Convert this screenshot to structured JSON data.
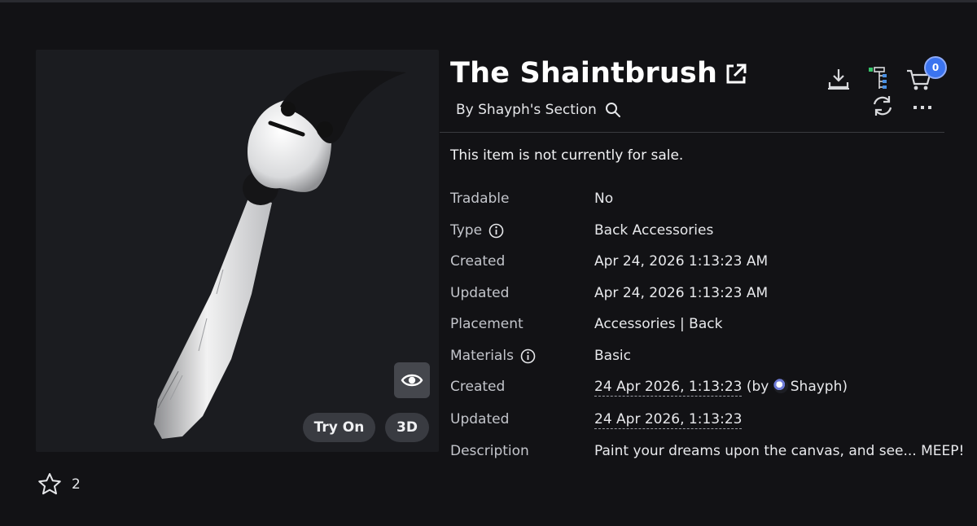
{
  "item": {
    "title": "The Shaintbrush",
    "byline": "By Shayph's Section",
    "sale_note": "This item is not currently for sale.",
    "favorite_count": "2"
  },
  "preview": {
    "try_on_label": "Try On",
    "three_d_label": "3D"
  },
  "toolbar": {
    "cart_count": "0"
  },
  "details": [
    {
      "label": "Tradable",
      "value": "No"
    },
    {
      "label": "Type",
      "value": "Back Accessories"
    },
    {
      "label": "Created",
      "value": "Apr 24, 2026 1:13:23 AM"
    },
    {
      "label": "Updated",
      "value": "Apr 24, 2026 1:13:23 AM"
    },
    {
      "label": "Placement",
      "value": "Accessories | Back"
    },
    {
      "label": "Materials",
      "value": "Basic"
    },
    {
      "label": "Created",
      "value": "24 Apr 2026, 1:13:23",
      "prefix": "(by ",
      "creator": "Shayph",
      "suffix": ")"
    },
    {
      "label": "Updated",
      "value": "24 Apr 2026, 1:13:23"
    },
    {
      "label": "Description",
      "value": "Paint your dreams upon the canvas, and see... MEEP!"
    }
  ],
  "colors": {
    "background": "#121215",
    "panel": "#1b1c20",
    "badge": "#3b74f0"
  },
  "icons": [
    "external-link-icon",
    "search-icon",
    "download-icon",
    "hierarchy-icon",
    "cart-icon",
    "refresh-icon",
    "more-icon",
    "eye-icon",
    "star-icon",
    "info-icon"
  ]
}
